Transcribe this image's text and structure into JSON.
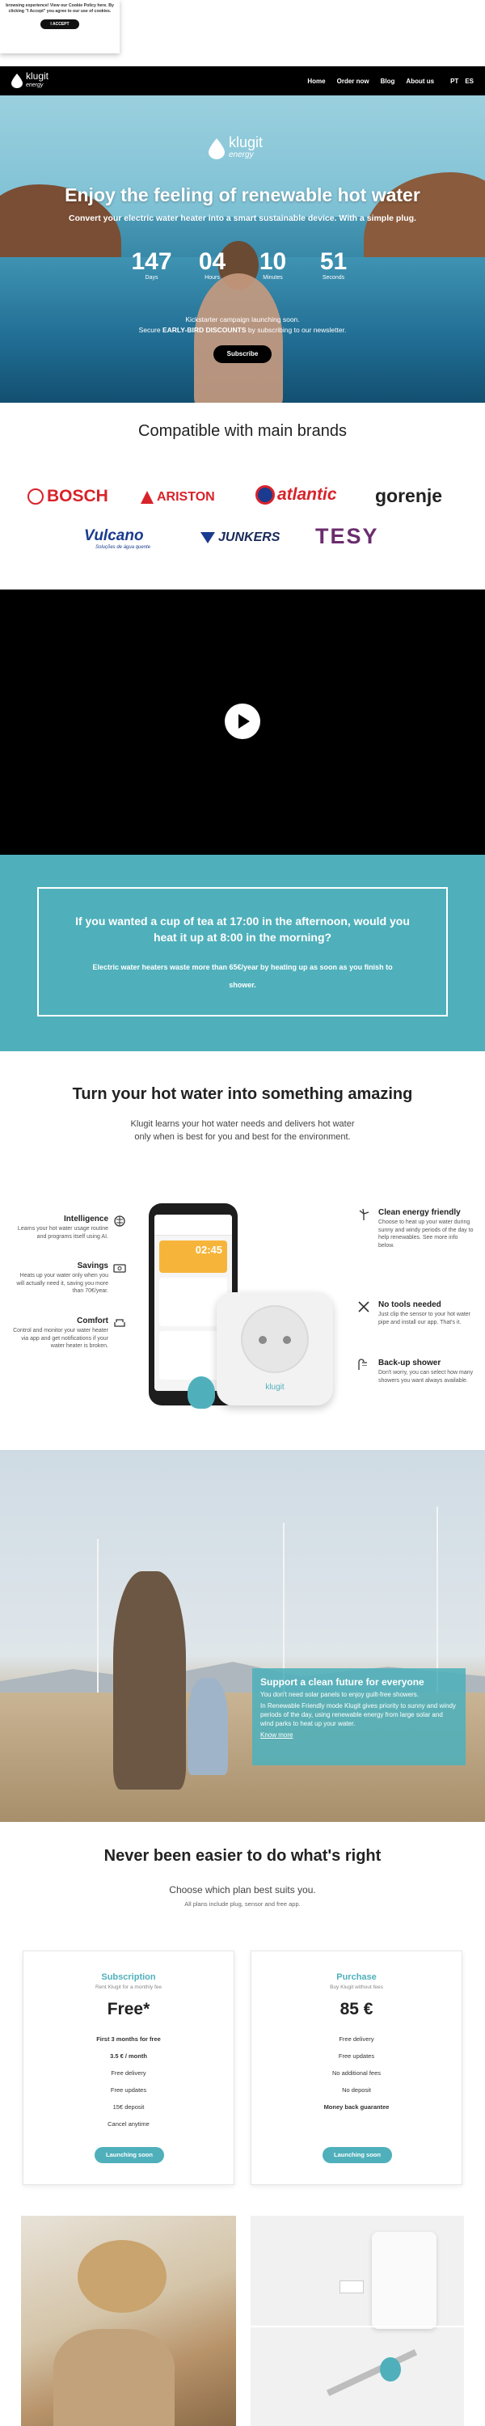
{
  "cookie": {
    "text": "browsing experience! View our Cookie Policy here. By clicking \"I Accept\" you agree to our use of cookies.",
    "accept": "I ACCEPT"
  },
  "nav": {
    "logo": "klugit",
    "logo_sub": "energy",
    "links": [
      "Home",
      "Order now",
      "Blog",
      "About us"
    ],
    "langs": [
      "PT",
      "ES"
    ]
  },
  "hero": {
    "logo": "klugit",
    "logo_sub": "energy",
    "title": "Enjoy the feeling of renewable hot water",
    "subtitle": "Convert your electric water heater into a smart sustainable device. With a simple plug.",
    "countdown": [
      {
        "value": "147",
        "unit": "Days"
      },
      {
        "value": "04",
        "unit": "Hours"
      },
      {
        "value": "10",
        "unit": "Minutes"
      },
      {
        "value": "51",
        "unit": "Seconds"
      }
    ],
    "kickstarter": "Kickstarter campaign launching soon.",
    "early_pre": "Secure ",
    "early_bold": "EARLY-BIRD DISCOUNTS",
    "early_post": " by subscribing to our newsletter.",
    "subscribe": "Subscribe"
  },
  "brands": {
    "title": "Compatible with main brands",
    "items": [
      "BOSCH",
      "ARISTON",
      "atlantic",
      "gorenje",
      "Vulcano",
      "JUNKERS",
      "TESY"
    ],
    "vulcano_tagline": "Soluções de água quente"
  },
  "teal": {
    "question": "If you wanted a cup of tea at 17:00 in the afternoon, would you heat it up at 8:00 in the morning?",
    "text": "Electric water heaters waste more than 65€/year by heating up as soon as you finish to shower."
  },
  "features": {
    "title": "Turn your hot water into something amazing",
    "description": "Klugit learns your hot water needs and delivers hot water only when is best for you and best for the environment.",
    "left": [
      {
        "title": "Intelligence",
        "text": "Learns your hot water usage routine and programs itself using AI."
      },
      {
        "title": "Savings",
        "text": "Heats up your water only when you will actually need it, saving you more than 70€/year."
      },
      {
        "title": "Comfort",
        "text": "Control and monitor your water heater via app and get notifications if your water heater is broken."
      }
    ],
    "right": [
      {
        "title": "Clean energy friendly",
        "text": "Choose to heat up your water during sunny and windy periods of the day to help renewables. See more info below."
      },
      {
        "title": "No tools needed",
        "text": "Just clip the sensor to your hot water pipe and install our app. That's it."
      },
      {
        "title": "Back-up shower",
        "text": "Don't worry, you can select how many showers you want always available."
      }
    ],
    "phone_time": "02:45",
    "plug_label": "klugit"
  },
  "cleanfuture": {
    "title": "Support a clean future for everyone",
    "text1": "You don't need solar panels to enjoy guilt-free showers.",
    "text2": "In Renewable Friendly mode Klugit gives priority to sunny and windy periods of the day, using renewable energy from large solar and wind parks to heat up your water.",
    "link": "Know more"
  },
  "plans": {
    "title": "Never been easier to do what's right",
    "subtitle": "Choose which plan best suits you.",
    "note": "All plans include plug, sensor and free app.",
    "subscription": {
      "name": "Subscription",
      "tagline": "Rent Klugit for a monthly fee",
      "price": "Free*",
      "items": [
        "First 3 months for free",
        "3.5 € / month",
        "Free delivery",
        "Free updates",
        "15€ deposit",
        "Cancel anytime"
      ],
      "button": "Launching soon"
    },
    "purchase": {
      "name": "Purchase",
      "tagline": "Buy Klugit without fees",
      "price": "85 €",
      "items": [
        "Free delivery",
        "Free updates",
        "No additional fees",
        "No deposit",
        "Money back guarantee"
      ],
      "button": "Launching soon"
    }
  },
  "colors": {
    "accent": "#4fb0bb",
    "nav_bg": "#000000"
  }
}
